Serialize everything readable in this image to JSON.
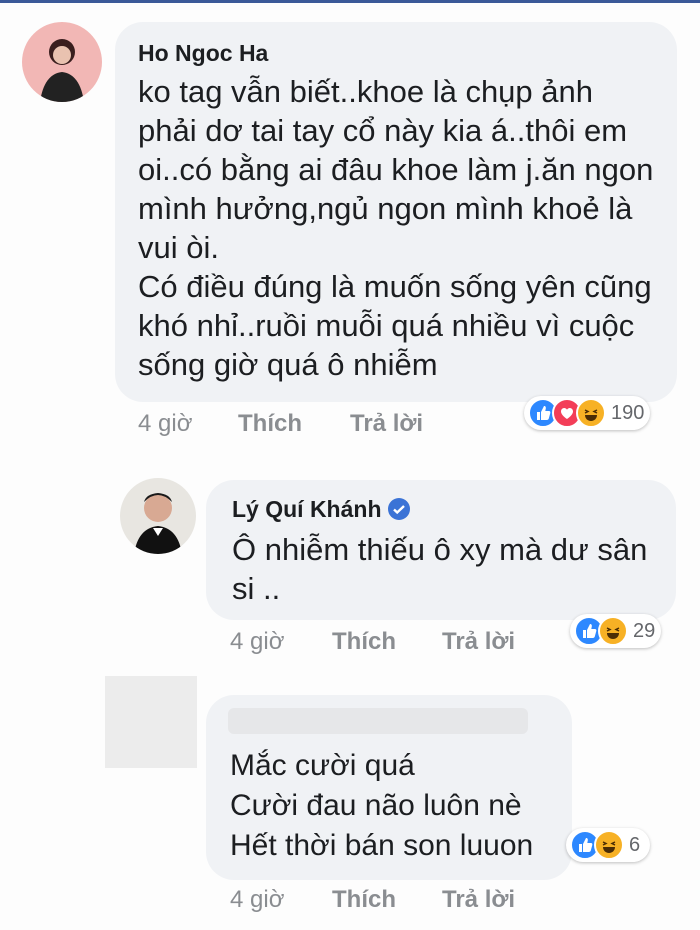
{
  "comments": [
    {
      "author": "Ho Ngoc Ha",
      "text": "ko tag vẫn biết..khoe là chụp ảnh\nphải dơ tai tay cổ này kia á..thôi em\noi..có bằng ai đâu khoe làm j.ăn ngon\nmình hưởng,ngủ ngon mình khoẻ là\nvui òi.\nCó điều đúng là muốn sống yên cũng\nkhó nhỉ..ruồi muỗi quá nhiều vì cuộc\nsống giờ quá ô nhiễm",
      "time": "4 giờ",
      "like_label": "Thích",
      "reply_label": "Trả lời",
      "reaction_icons": [
        "like-icon",
        "love-icon",
        "haha-icon"
      ],
      "reaction_count": "190"
    },
    {
      "author": "Lý Quí Khánh",
      "verified": true,
      "text": "Ô nhiễm thiếu ô xy mà dư sân\nsi ..",
      "time": "4 giờ",
      "like_label": "Thích",
      "reply_label": "Trả lời",
      "reaction_icons": [
        "like-icon",
        "haha-icon"
      ],
      "reaction_count": "29"
    },
    {
      "author": "",
      "text": "Mắc cười quá\nCười đau não luôn nè\nHết thời bán son luuon",
      "time": "4 giờ",
      "like_label": "Thích",
      "reply_label": "Trả lời",
      "reaction_icons": [
        "like-icon",
        "haha-icon"
      ],
      "reaction_count": "6"
    }
  ],
  "colors": {
    "bubble": "#f0f2f5",
    "like": "#2d88ff",
    "love": "#f33e58",
    "haha": "#f7b125",
    "meta": "#8a8d91"
  }
}
